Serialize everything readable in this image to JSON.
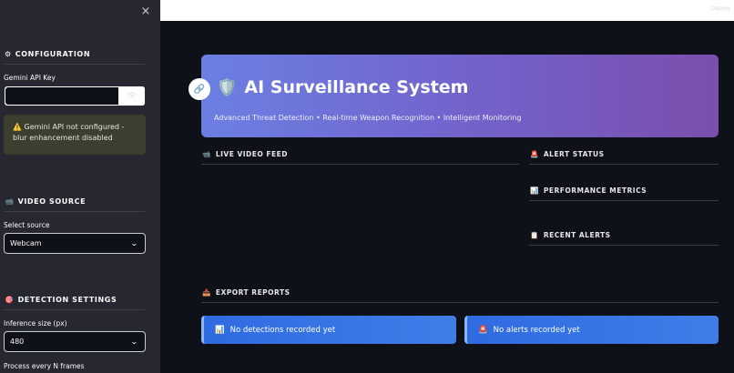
{
  "sidebar": {
    "close_icon": "×",
    "config": {
      "icon": "⚙",
      "title": "CONFIGURATION"
    },
    "api_key": {
      "label": "Gemini API Key",
      "value": "",
      "eye_icon": "👁"
    },
    "warning": {
      "icon": "⚠️",
      "text": "Gemini API not configured - blur enhancement disabled"
    },
    "video": {
      "icon": "📹",
      "title": "VIDEO SOURCE",
      "select_label": "Select source",
      "selected": "Webcam"
    },
    "detection": {
      "icon": "🎯",
      "title": "DETECTION SETTINGS",
      "size_label": "Inference size (px)",
      "size_value": "480",
      "frames_label": "Process every N frames"
    },
    "chevron": "⌄"
  },
  "topbar": {
    "deploy_label": "Deploy"
  },
  "hero": {
    "link_icon": "🔗",
    "shield_icon": "🛡️",
    "title": "AI Surveillance System",
    "subtitle": "Advanced Threat Detection • Real-time Weapon Recognition • Intelligent Monitoring"
  },
  "sections": {
    "live_feed": {
      "icon": "📹",
      "title": "LIVE VIDEO FEED"
    },
    "alert_status": {
      "icon": "🚨",
      "title": "ALERT STATUS"
    },
    "performance": {
      "icon": "📊",
      "title": "PERFORMANCE METRICS"
    },
    "recent_alerts": {
      "icon": "📋",
      "title": "RECENT ALERTS"
    },
    "export": {
      "icon": "📥",
      "title": "EXPORT REPORTS"
    }
  },
  "info": {
    "detections": {
      "icon": "📊",
      "text": "No detections recorded yet"
    },
    "alerts": {
      "icon": "🚨",
      "text": "No alerts recorded yet"
    }
  },
  "colors": {
    "sidebar_bg": "#262730",
    "main_bg": "#0e1117",
    "hero_start": "#6c7fe3",
    "hero_end": "#7a4fae",
    "info_bg": "#2f6be0"
  }
}
